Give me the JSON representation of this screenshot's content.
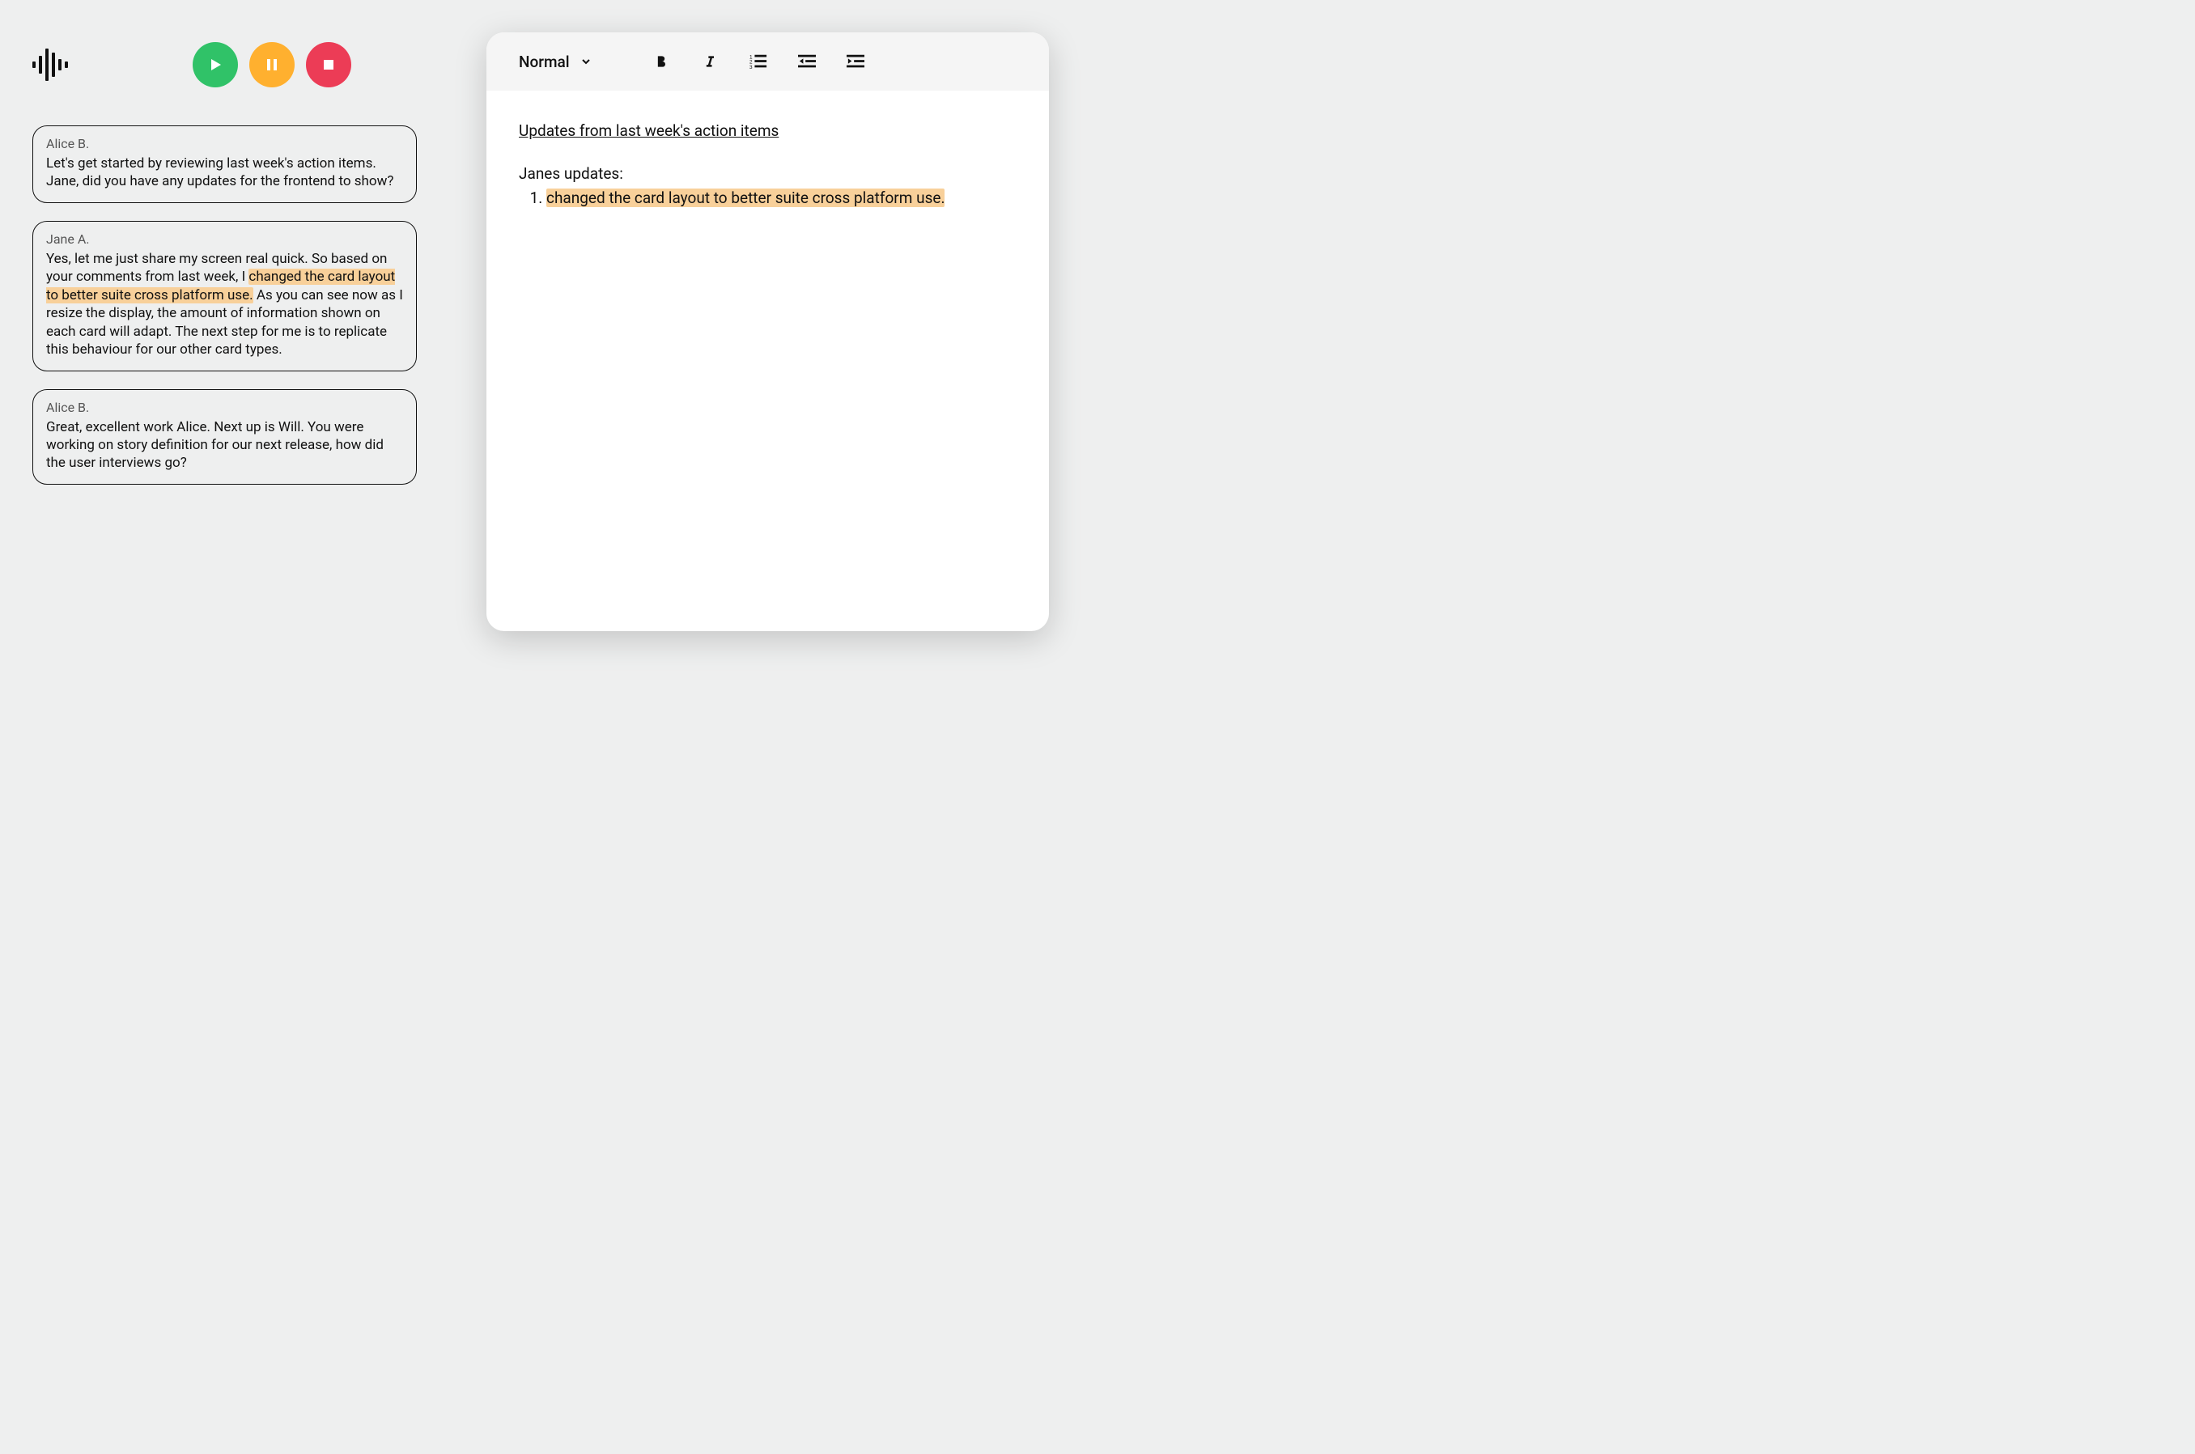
{
  "audio": {
    "controls": {
      "play": "play",
      "pause": "pause",
      "stop": "stop"
    }
  },
  "transcript": [
    {
      "speaker": "Alice B.",
      "text_before": "Let's get started by reviewing last week's action items. Jane, did you have any updates for the frontend to show?",
      "highlight": "",
      "text_after": ""
    },
    {
      "speaker": "Jane A.",
      "text_before": "Yes, let me just share my screen real quick. So based on your comments from last week, I ",
      "highlight": "changed the card layout to better suite cross platform use.",
      "text_after": " As you can see now as I resize the display, the amount of information shown on each card will adapt. The next step for me is to replicate this behaviour for our other card types."
    },
    {
      "speaker": "Alice B.",
      "text_before": "Great, excellent work Alice. Next up is Will. You were working on story definition for our next release, how did the user interviews go?",
      "highlight": "",
      "text_after": ""
    }
  ],
  "editor": {
    "toolbar": {
      "style_label": "Normal"
    },
    "doc": {
      "heading": "Updates from last week's action items",
      "subhead": "Janes updates:",
      "list_marker": "1.",
      "list_item_highlight": "changed the card layout to better suite cross platform use."
    }
  },
  "colors": {
    "play": "#30c268",
    "pause": "#ffb02f",
    "stop": "#ec3c56",
    "highlight": "#f8d09a"
  }
}
